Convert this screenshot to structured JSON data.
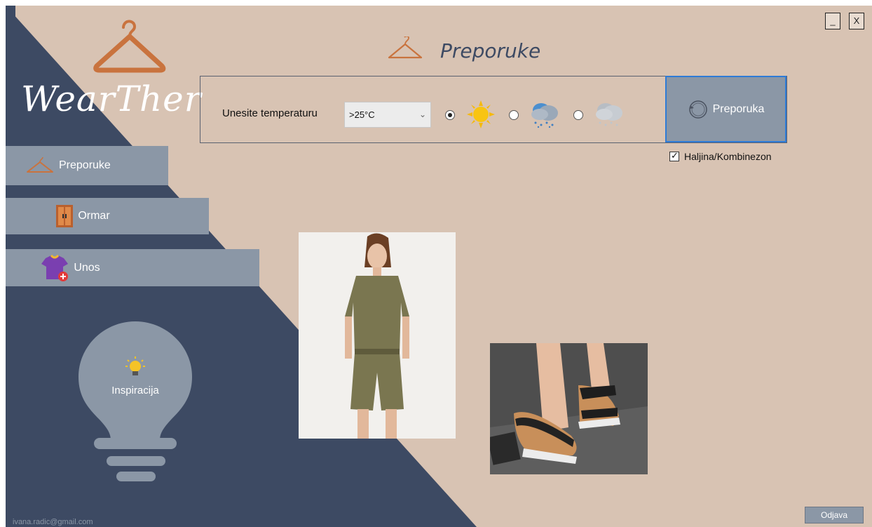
{
  "app": {
    "logo_text": "WearTher"
  },
  "window_controls": {
    "minimize_label": "_",
    "close_label": "X"
  },
  "header": {
    "title": "Preporuke"
  },
  "sidebar": {
    "items": [
      {
        "label": "Preporuke",
        "icon": "hanger-icon"
      },
      {
        "label": "Ormar",
        "icon": "wardrobe-icon"
      },
      {
        "label": "Unos",
        "icon": "add-shirt-icon"
      }
    ],
    "inspiration_label": "Inspiracija",
    "user_email": "ivana.radic@gmail.com"
  },
  "filters": {
    "temperature_label": "Unesite temperaturu",
    "temperature_value": ">25°C",
    "weather_options": [
      {
        "icon": "sun-icon",
        "selected": true
      },
      {
        "icon": "rain-cloud-icon",
        "selected": false
      },
      {
        "icon": "snow-cloud-icon",
        "selected": false
      }
    ],
    "dress_checkbox_label": "Haljina/Kombinezon",
    "dress_checkbox_checked": true
  },
  "recommend_button_label": "Preporuka",
  "products": [
    {
      "kind": "jumpsuit"
    },
    {
      "kind": "sandals"
    }
  ],
  "logout_label": "Odjava",
  "colors": {
    "background": "#d8c3b3",
    "navy": "#3d4a63",
    "button_gray": "#8b97a6",
    "accent_orange": "#c9733e",
    "focus_blue": "#2e7bd6"
  }
}
